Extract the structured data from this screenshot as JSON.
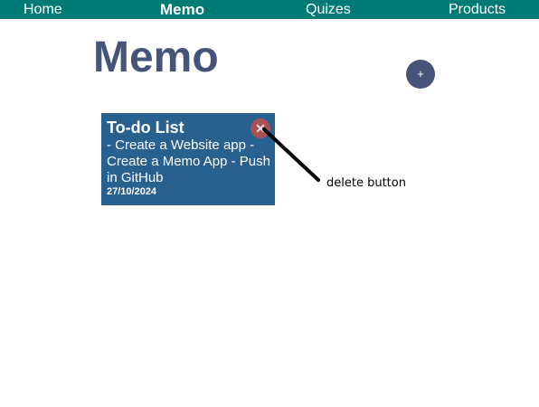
{
  "nav": {
    "items": [
      {
        "label": "Home"
      },
      {
        "label": "Memo"
      },
      {
        "label": "Quizes"
      },
      {
        "label": "Products"
      }
    ]
  },
  "main": {
    "title": "Memo",
    "add_label": "+"
  },
  "memo": {
    "title": "To-do List",
    "body": "- Create a Website app - Create a Memo App - Push in GitHub",
    "date": "27/10/2024",
    "delete_label": "✕"
  },
  "annotation": {
    "label": "delete button"
  },
  "colors": {
    "nav_bg": "#007a75",
    "title": "#465479",
    "card_bg": "#286090",
    "delete": "#c0504d"
  }
}
